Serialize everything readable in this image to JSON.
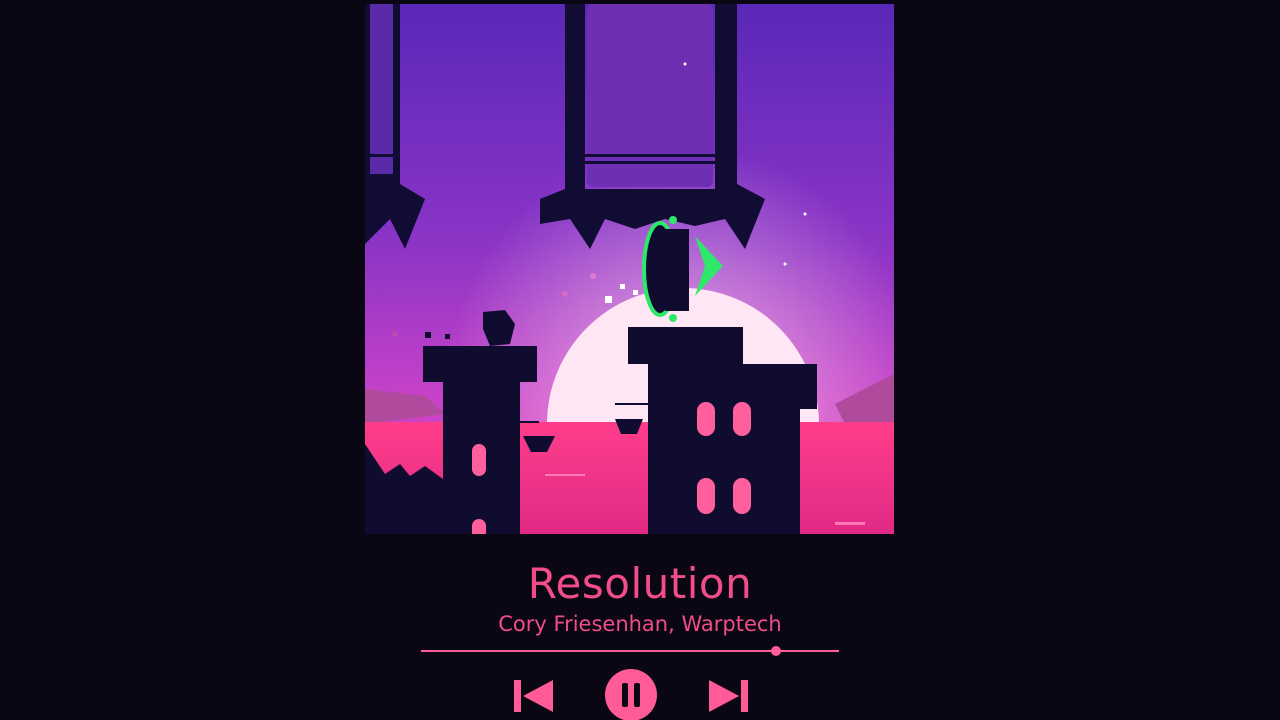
{
  "track": {
    "title": "Resolution",
    "artist": "Cory Friesenhan, Warptech"
  },
  "playback": {
    "progress_fraction": 0.85,
    "state": "playing"
  },
  "controls": {
    "previous_icon": "skip-previous-icon",
    "pause_icon": "pause-icon",
    "next_icon": "skip-next-icon"
  },
  "colors": {
    "accent": "#f04d8a",
    "background": "#0b0614"
  }
}
